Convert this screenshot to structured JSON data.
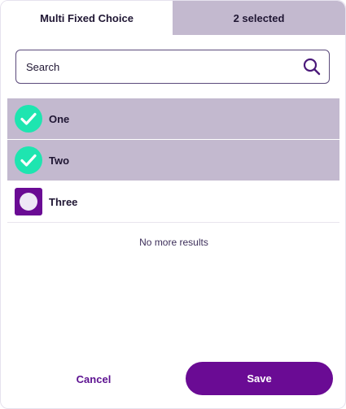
{
  "tabs": {
    "left_label": "Multi Fixed Choice",
    "right_label": "2 selected"
  },
  "search": {
    "placeholder": "Search",
    "value": ""
  },
  "options": [
    {
      "label": "One",
      "selected": true
    },
    {
      "label": "Two",
      "selected": true
    },
    {
      "label": "Three",
      "selected": false
    }
  ],
  "status": {
    "no_more_results": "No more results"
  },
  "actions": {
    "cancel_label": "Cancel",
    "save_label": "Save"
  },
  "colors": {
    "accent": "#6a0b94",
    "selected_row": "#c3b9cf",
    "check_fill": "#1ee5b0",
    "unchecked_fill": "#6a0b94"
  },
  "icons": {
    "search": "search-icon",
    "checked": "checkmark-circle-icon",
    "unchecked": "empty-circle-icon"
  }
}
